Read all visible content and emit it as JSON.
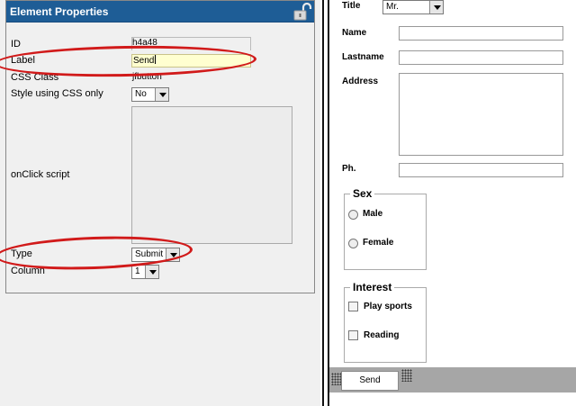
{
  "properties": {
    "title": "Element Properties",
    "id_label": "ID",
    "id_value": "h4a48",
    "label_label": "Label",
    "label_value": "Send",
    "css_class_label": "CSS Class",
    "css_class_value": "jfbutton",
    "style_label": "Style using CSS only",
    "style_value": "No",
    "onclick_label": "onClick script",
    "type_label": "Type",
    "type_value": "Submit",
    "column_label": "Column",
    "column_value": "1"
  },
  "form": {
    "title_label": "Title",
    "title_value": "Mr.",
    "name_label": "Name",
    "lastname_label": "Lastname",
    "address_label": "Address",
    "phone_label": "Ph.",
    "sex_legend": "Sex",
    "sex_options": [
      "Male",
      "Female"
    ],
    "interest_legend": "Interest",
    "interest_options": [
      "Play sports",
      "Reading"
    ],
    "send_label": "Send"
  },
  "colors": {
    "header": "#1e5d96",
    "highlight_oval": "#d11a1a",
    "active_field": "#ffffd0",
    "footer_bar": "#a6a6a6"
  },
  "icons": {
    "lock": "unlocked-padlock-icon",
    "dropdown": "chevron-down-icon",
    "grip": "resize-grip-icon"
  }
}
